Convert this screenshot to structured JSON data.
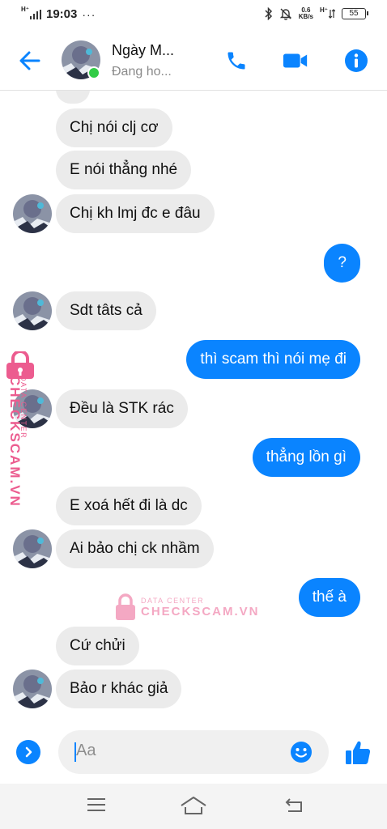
{
  "status_bar": {
    "network_label": "H⁺",
    "time": "19:03",
    "more": "···",
    "speed_value": "0.6",
    "speed_unit": "KB/s",
    "network_label_right": "H⁺",
    "battery": "55"
  },
  "header": {
    "contact_name": "Ngày M...",
    "contact_status": "Đang ho...",
    "online": true,
    "accent_color": "#0a84ff"
  },
  "messages": [
    {
      "side": "in",
      "text": "Chị nói clj cơ",
      "avatar": false
    },
    {
      "side": "in",
      "text": "E nói thẳng nhé",
      "avatar": false
    },
    {
      "side": "in",
      "text": "Chị kh lmj đc e đâu",
      "avatar": true
    },
    {
      "side": "out",
      "text": "?"
    },
    {
      "side": "in",
      "text": "Sdt tâts cả",
      "avatar": true
    },
    {
      "side": "out",
      "text": "thì scam thì nói mẹ đi"
    },
    {
      "side": "in",
      "text": "Đều là STK rác",
      "avatar": true
    },
    {
      "side": "out",
      "text": "thẳng lồn gì"
    },
    {
      "side": "in",
      "text": "E xoá hết đi là dc",
      "avatar": false
    },
    {
      "side": "in",
      "text": "Ai bảo chị ck nhầm",
      "avatar": true
    },
    {
      "side": "out",
      "text": "thế à"
    },
    {
      "side": "in",
      "text": "Cứ chửi",
      "avatar": false
    },
    {
      "side": "in",
      "text": "Bảo r khác giả",
      "avatar": true
    }
  ],
  "watermark": {
    "small": "DATA CENTER",
    "big": "CHECKSCAM.VN"
  },
  "composer": {
    "placeholder": "Aa"
  },
  "icons": {
    "back": "back-arrow-icon",
    "call": "phone-icon",
    "video": "video-camera-icon",
    "info": "info-icon",
    "expand": "chevron-right-icon",
    "emoji": "emoji-icon",
    "like": "thumbs-up-icon",
    "nav_menu": "menu-icon",
    "nav_home": "home-icon",
    "nav_back": "back-icon"
  }
}
